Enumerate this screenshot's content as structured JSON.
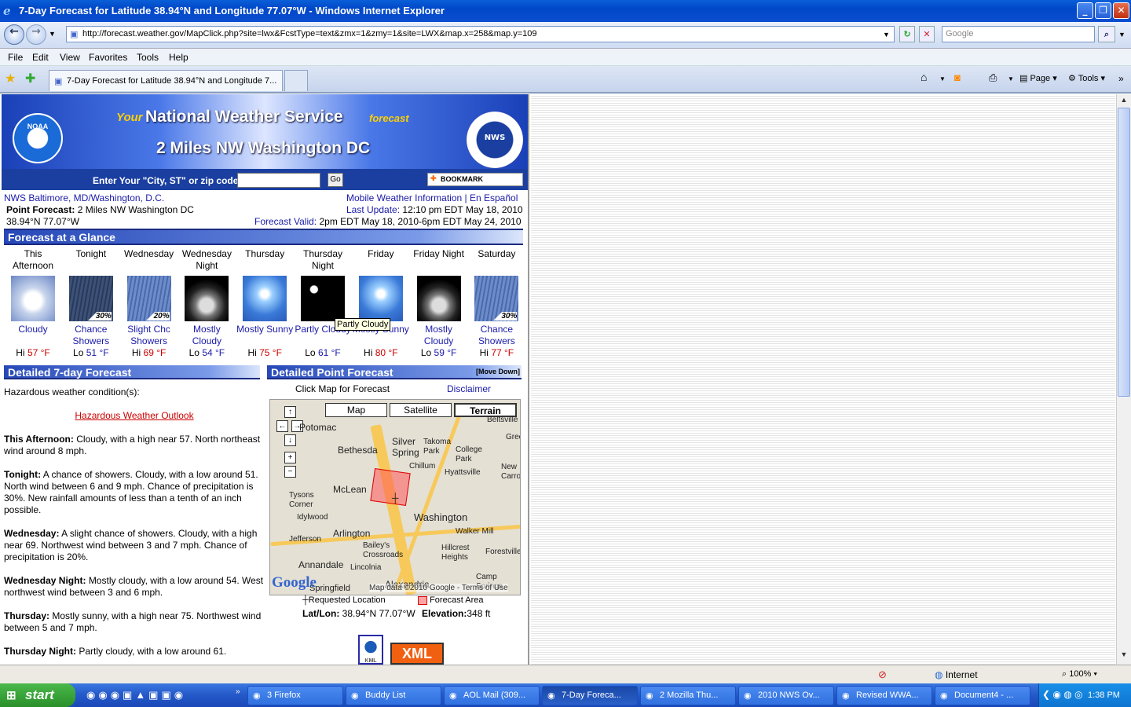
{
  "window": {
    "title": "7-Day Forecast for Latitude 38.94°N and Longitude 77.07°W - Windows Internet Explorer"
  },
  "address": {
    "url": "http://forecast.weather.gov/MapClick.php?site=lwx&FcstType=text&zmx=1&zmy=1&site=LWX&map.x=258&map.y=109",
    "search_placeholder": "Google"
  },
  "menu": [
    "File",
    "Edit",
    "View",
    "Favorites",
    "Tools",
    "Help"
  ],
  "tab": {
    "label": "7-Day Forecast for Latitude 38.94°N and Longitude 7..."
  },
  "toolbar": {
    "page": "Page",
    "tools": "Tools"
  },
  "banner": {
    "your": "Your",
    "nws": "National Weather Service",
    "forecast": "forecast",
    "location": "2 Miles NW Washington DC",
    "noaa": "NOAA",
    "nws_seal": "NWS"
  },
  "search": {
    "label": "Enter Your \"City, ST\" or zip code",
    "go": "Go",
    "bookmark": "BOOKMARK"
  },
  "info": {
    "office": "NWS Baltimore, MD/Washington, D.C.",
    "point_label": "Point Forecast:",
    "point_value": "2 Miles NW Washington DC",
    "latlon": "38.94°N 77.07°W",
    "mobile": "Mobile Weather Information",
    "sep": " | ",
    "espanol": "En Español",
    "last_update_label": "Last Update:",
    "last_update": "12:10 pm EDT May 18, 2010",
    "valid_label": "Forecast Valid:",
    "valid": "2pm EDT May 18, 2010-6pm EDT May 24, 2010"
  },
  "glance": {
    "title": "Forecast at a Glance",
    "periods": [
      {
        "name": "This Afternoon",
        "desc": "Cloudy",
        "hilo": "Hi",
        "temp": "57 °F",
        "pct": "",
        "icon": "cloud-icon"
      },
      {
        "name": "Tonight",
        "desc": "Chance Showers",
        "hilo": "Lo",
        "temp": "51 °F",
        "pct": "30%",
        "icon": "rain-icon"
      },
      {
        "name": "Wednesday",
        "desc": "Slight Chc Showers",
        "hilo": "Hi",
        "temp": "69 °F",
        "pct": "20%",
        "icon": "rain-icon"
      },
      {
        "name": "Wednesday Night",
        "desc": "Mostly Cloudy",
        "hilo": "Lo",
        "temp": "54 °F",
        "pct": "",
        "icon": "night-cloud-icon"
      },
      {
        "name": "Thursday",
        "desc": "Mostly Sunny",
        "hilo": "Hi",
        "temp": "75 °F",
        "pct": "",
        "icon": "sun-icon"
      },
      {
        "name": "Thursday Night",
        "desc": "Partly Cloudy",
        "hilo": "Lo",
        "temp": "61 °F",
        "pct": "",
        "icon": "night-partly-icon"
      },
      {
        "name": "Friday",
        "desc": "Mostly Sunny",
        "hilo": "Hi",
        "temp": "80 °F",
        "pct": "",
        "icon": "sun-icon"
      },
      {
        "name": "Friday Night",
        "desc": "Mostly Cloudy",
        "hilo": "Lo",
        "temp": "59 °F",
        "pct": "",
        "icon": "night-cloud-icon"
      },
      {
        "name": "Saturday",
        "desc": "Chance Showers",
        "hilo": "Hi",
        "temp": "77 °F",
        "pct": "30%",
        "icon": "rain-icon"
      }
    ],
    "tooltip": "Partly Cloudy"
  },
  "detailed": {
    "title": "Detailed 7-day Forecast",
    "hazard_intro": "Hazardous weather condition(s):",
    "hazard_link": "Hazardous Weather Outlook",
    "items": [
      {
        "period": "This Afternoon:",
        "text": "Cloudy, with a high near 57. North northeast wind around 8 mph."
      },
      {
        "period": "Tonight:",
        "text": "A chance of showers. Cloudy, with a low around 51. North wind between 6 and 9 mph. Chance of precipitation is 30%. New rainfall amounts of less than a tenth of an inch possible."
      },
      {
        "period": "Wednesday:",
        "text": "A slight chance of showers. Cloudy, with a high near 69. Northwest wind between 3 and 7 mph. Chance of precipitation is 20%."
      },
      {
        "period": "Wednesday Night:",
        "text": "Mostly cloudy, with a low around 54. West northwest wind between 3 and 6 mph."
      },
      {
        "period": "Thursday:",
        "text": "Mostly sunny, with a high near 75. Northwest wind between 5 and 7 mph."
      },
      {
        "period": "Thursday Night:",
        "text": "Partly cloudy, with a low around 61."
      }
    ]
  },
  "point": {
    "title": "Detailed Point Forecast",
    "move": "[Move Down]",
    "click_map": "Click Map for Forecast",
    "disclaimer": "Disclaimer",
    "map_types": [
      "Map",
      "Satellite",
      "Terrain"
    ],
    "map_labels": [
      "Bethesda",
      "Silver Spring",
      "Takoma Park",
      "College Park",
      "Chillum",
      "Hyattsville",
      "McLean",
      "Tysons Corner",
      "Idylwood",
      "Washington",
      "Arlington",
      "Jefferson",
      "Bailey's Crossroads",
      "Walker Mill",
      "Hillcrest Heights",
      "Forestville",
      "Annandale",
      "Lincolnia",
      "Alexandria",
      "Springfield",
      "Camp Springs",
      "New Carrollton",
      "Beltsville",
      "Potomac",
      "Greenbelt"
    ],
    "map_credit": "Map data ©2010 Google - Terms of Use",
    "google": "Google",
    "legend_req": "Requested Location",
    "legend_area": "Forecast Area",
    "latlon_label": "Lat/Lon:",
    "latlon": "38.94°N 77.07°W",
    "elev_label": "Elevation:",
    "elev": "348 ft",
    "kml": "KML",
    "xml": "XML"
  },
  "statusbar": {
    "zone": "Internet",
    "zoom": "100%"
  },
  "taskbar": {
    "start": "start",
    "tasks": [
      "3 Firefox",
      "Buddy List",
      "AOL Mail (309...",
      "7-Day Foreca...",
      "2 Mozilla Thu...",
      "2010 NWS Ov...",
      "Revised WWA...",
      "Document4 - ..."
    ],
    "clock": "1:38 PM"
  },
  "colors": {
    "title_blue": "#0047c8",
    "nws_blue": "#1a3fa0",
    "hi_red": "#c00",
    "lo_blue": "#1a1aa8",
    "xml_orange": "#f06010"
  }
}
